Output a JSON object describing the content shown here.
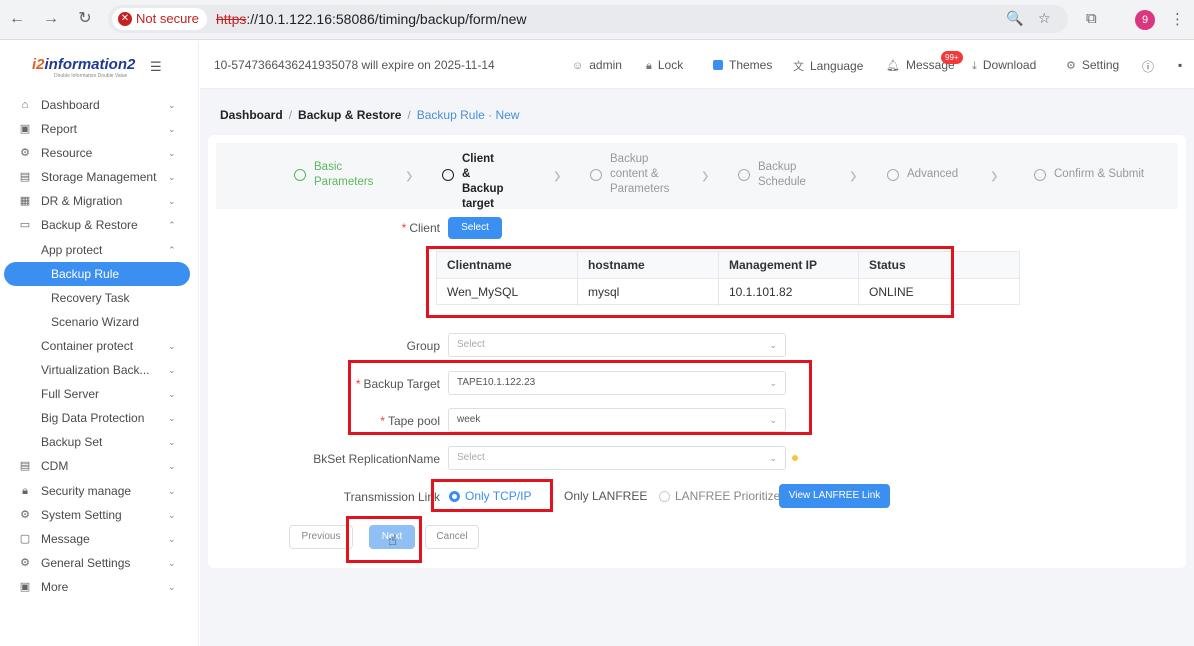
{
  "browser": {
    "not_secure": "Not secure",
    "url_scheme": "https",
    "url_rest": "://10.1.122.16:58086/timing/backup/form/new",
    "avatar_letter": "9"
  },
  "sidebar": {
    "logo_prefix": "i2",
    "logo_text": "information2",
    "logo_tag": "Double Information Double Value",
    "items": [
      {
        "label": "Dashboard",
        "icon": "home-icon",
        "chevron": "⌄"
      },
      {
        "label": "Report",
        "icon": "report-icon",
        "chevron": "⌄"
      },
      {
        "label": "Resource",
        "icon": "resource-icon",
        "chevron": "⌄"
      },
      {
        "label": "Storage Management",
        "icon": "storage-icon",
        "chevron": "⌄"
      },
      {
        "label": "DR & Migration",
        "icon": "dr-icon",
        "chevron": "⌄"
      },
      {
        "label": "Backup & Restore",
        "icon": "backup-icon",
        "chevron": "⌃"
      },
      {
        "label": "App protect",
        "chevron": "⌃"
      },
      {
        "label": "Backup Rule"
      },
      {
        "label": "Recovery Task"
      },
      {
        "label": "Scenario Wizard"
      },
      {
        "label": "Container protect",
        "chevron": "⌄"
      },
      {
        "label": "Virtualization Back...",
        "chevron": "⌄"
      },
      {
        "label": "Full Server",
        "chevron": "⌄"
      },
      {
        "label": "Big Data Protection",
        "chevron": "⌄"
      },
      {
        "label": "Backup Set",
        "chevron": "⌄"
      },
      {
        "label": "CDM",
        "icon": "cdm-icon",
        "chevron": "⌄"
      },
      {
        "label": "Security manage",
        "icon": "lock-icon",
        "chevron": "⌄"
      },
      {
        "label": "System Setting",
        "icon": "gear-icon",
        "chevron": "⌄"
      },
      {
        "label": "Message",
        "icon": "message-icon",
        "chevron": "⌄"
      },
      {
        "label": "General Settings",
        "icon": "settings-icon",
        "chevron": "⌄"
      },
      {
        "label": "More",
        "icon": "more-icon",
        "chevron": "⌄"
      }
    ]
  },
  "topbar": {
    "expire_text": "10-5747366436241935078 will expire on 2025-11-14",
    "admin": "admin",
    "lock": "Lock",
    "themes": "Themes",
    "language": "Language",
    "message": "Message",
    "message_badge": "99+",
    "download": "Download",
    "setting": "Setting"
  },
  "breadcrumb": {
    "home": "Dashboard",
    "section": "Backup & Restore",
    "current": "Backup Rule · New"
  },
  "steps": [
    {
      "line1": "Basic",
      "line2": "Parameters",
      "line3": ""
    },
    {
      "line1": "Client &",
      "line2": "Backup",
      "line3": "target"
    },
    {
      "line1": "Backup",
      "line2": "content &",
      "line3": "Parameters"
    },
    {
      "line1": "Backup",
      "line2": "Schedule",
      "line3": ""
    },
    {
      "line1": "Advanced",
      "line2": "",
      "line3": ""
    },
    {
      "line1": "Confirm & Submit",
      "line2": "",
      "line3": ""
    }
  ],
  "form": {
    "client_label": "Client",
    "client_button": "Select",
    "table": {
      "headers": [
        "Clientname",
        "hostname",
        "Management IP",
        "Status"
      ],
      "row": [
        "Wen_MySQL",
        "mysql",
        "10.1.101.82",
        "ONLINE"
      ]
    },
    "group_label": "Group",
    "group_placeholder": "Select",
    "backup_target_label": "Backup Target",
    "backup_target_value": "TAPE10.1.122.23",
    "tape_pool_label": "Tape pool",
    "tape_pool_value": "week",
    "replication_label": "BkSet ReplicationName",
    "replication_placeholder": "Select",
    "transmission_label": "Transmission Link",
    "link_options": [
      "Only TCP/IP",
      "Only LANFREE",
      "LANFREE Prioritized"
    ],
    "view_link_button": "View LANFREE Link",
    "previous_button": "Previous",
    "next_button": "Next",
    "cancel_button": "Cancel"
  },
  "colors": {
    "accent": "#3b8ff0",
    "highlight": "#e0131f",
    "done": "#5cb85c"
  }
}
